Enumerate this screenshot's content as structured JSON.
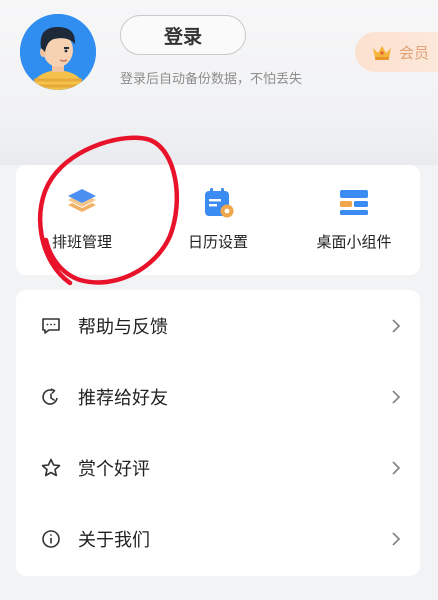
{
  "header": {
    "login_button": "登录",
    "login_hint": "登录后自动备份数据，不怕丢失",
    "vip_label": "会员"
  },
  "tools": [
    {
      "label": "排班管理",
      "icon": "layers-icon"
    },
    {
      "label": "日历设置",
      "icon": "calendar-settings-icon"
    },
    {
      "label": "桌面小组件",
      "icon": "widget-icon"
    }
  ],
  "menu": [
    {
      "label": "帮助与反馈",
      "icon": "feedback-icon"
    },
    {
      "label": "推荐给好友",
      "icon": "share-icon"
    },
    {
      "label": "赏个好评",
      "icon": "star-icon"
    },
    {
      "label": "关于我们",
      "icon": "info-icon"
    }
  ],
  "colors": {
    "accent_blue": "#3b8cf2",
    "layers_orange": "#f0b065",
    "vip_text": "#e0a176",
    "annotation_red": "#e8132a"
  }
}
